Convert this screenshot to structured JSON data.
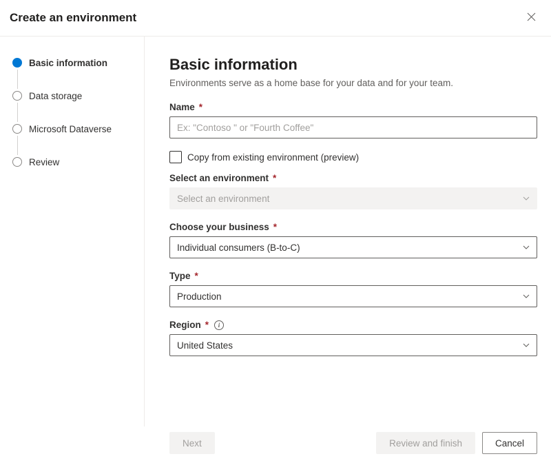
{
  "header": {
    "title": "Create an environment"
  },
  "steps": [
    {
      "label": "Basic information",
      "active": true
    },
    {
      "label": "Data storage",
      "active": false
    },
    {
      "label": "Microsoft Dataverse",
      "active": false
    },
    {
      "label": "Review",
      "active": false
    }
  ],
  "main": {
    "heading": "Basic information",
    "subtitle": "Environments serve as a home base for your data and for your team.",
    "name_field": {
      "label": "Name",
      "placeholder": "Ex: \"Contoso \" or \"Fourth Coffee\"",
      "value": ""
    },
    "copy_checkbox": {
      "label": "Copy from existing environment (preview)",
      "checked": false
    },
    "select_env": {
      "label": "Select an environment",
      "placeholder": "Select an environment",
      "disabled": true
    },
    "business": {
      "label": "Choose your business",
      "value": "Individual consumers (B-to-C)"
    },
    "type": {
      "label": "Type",
      "value": "Production"
    },
    "region": {
      "label": "Region",
      "value": "United States"
    }
  },
  "footer": {
    "next": "Next",
    "review": "Review and finish",
    "cancel": "Cancel"
  }
}
